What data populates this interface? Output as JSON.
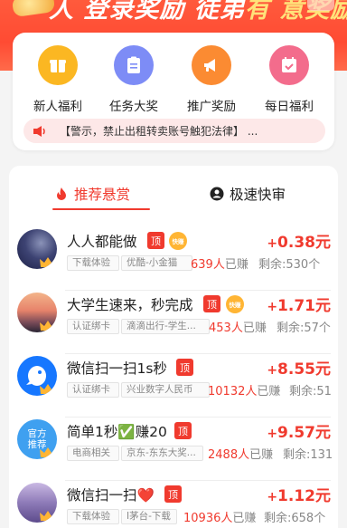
{
  "banner": {
    "text_white": "人 登录奖励",
    "text_mid": " 徒弟",
    "text_yellow": "有 意奖励"
  },
  "menu": {
    "items": [
      {
        "label": "新人福利",
        "icon": "gift-box-icon",
        "color": "#fbb722"
      },
      {
        "label": "任务大奖",
        "icon": "clipboard-icon",
        "color": "#7d8cf6"
      },
      {
        "label": "推广奖励",
        "icon": "megaphone-icon",
        "color": "#fb8b32"
      },
      {
        "label": "每日福利",
        "icon": "calendar-check-icon",
        "color": "#f36c8c"
      }
    ],
    "notice": "【警示，禁止出租转卖账号触犯法律】 ..."
  },
  "tabs": [
    {
      "label": "推荐悬赏",
      "icon": "flame-icon",
      "active": true
    },
    {
      "label": "极速快审",
      "icon": "user-circle-icon",
      "active": false
    }
  ],
  "tasks": [
    {
      "title": "人人都能做",
      "top_badge": "顶",
      "fast_badge": "快赚",
      "tags": [
        "下载体验",
        "优酷-小金猫"
      ],
      "done_count": "639人",
      "done_suffix": "已赚",
      "remain": "剩余:530个",
      "reward_plus": "+",
      "reward": "0.38元",
      "avatar": "night-sky-avatar"
    },
    {
      "title": "大学生速来，秒完成",
      "top_badge": "顶",
      "fast_badge": "快赚",
      "tags": [
        "认证绑卡",
        "滴滴出行-学生..."
      ],
      "done_count": "453人",
      "done_suffix": "已赚",
      "remain": "剩余:57个",
      "reward_plus": "+",
      "reward": "1.71元",
      "avatar": "sunset-avatar"
    },
    {
      "title": "微信扫一扫1s秒",
      "top_badge": "顶",
      "fast_badge": "",
      "tags": [
        "认证绑卡",
        "兴业数字人民币"
      ],
      "done_count": "10132人",
      "done_suffix": "已赚",
      "remain": "剩余:51",
      "reward_plus": "+",
      "reward": "8.55元",
      "avatar": "blue-bird-avatar"
    },
    {
      "title": "简单1秒✅赚20",
      "top_badge": "顶",
      "fast_badge": "",
      "tags": [
        "电商相关",
        "京东-东东大奖..."
      ],
      "done_count": "2488人",
      "done_suffix": "已赚",
      "remain": "剩余:131",
      "reward_plus": "+",
      "reward": "9.57元",
      "avatar": "official-recommend-avatar",
      "avatar_text": "官方\n推荐"
    },
    {
      "title": "微信扫一扫❤️",
      "top_badge": "顶",
      "fast_badge": "",
      "tags": [
        "下载体验",
        "I茅台-下载"
      ],
      "done_count": "10936人",
      "done_suffix": "已赚",
      "remain": "剩余:658个",
      "reward_plus": "+",
      "reward": "1.12元",
      "avatar": "lavender-avatar"
    }
  ]
}
